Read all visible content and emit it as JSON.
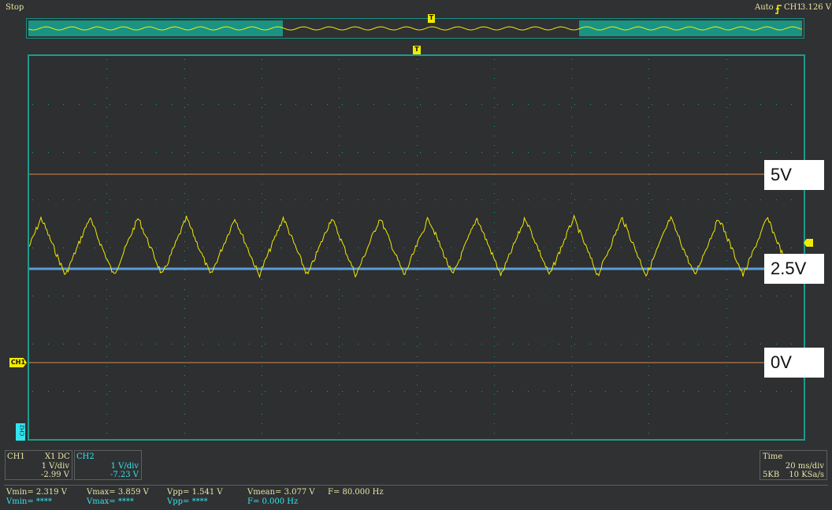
{
  "status": {
    "run_state": "Stop",
    "trigger_mode": "Auto",
    "trigger_channel": "CH1",
    "trigger_level": "3.126 V"
  },
  "markers": {
    "trigger": "T",
    "ch1": "CH1",
    "ch2": "CH2"
  },
  "reference_labels": {
    "top": "5V",
    "middle": "2.5V",
    "bottom": "0V"
  },
  "ch1_panel": {
    "name": "CH1",
    "probe": "X1",
    "coupling": "DC",
    "scale": "1 V/div",
    "offset": "-2.99 V"
  },
  "ch2_panel": {
    "name": "CH2",
    "scale": "1 V/div",
    "offset": "-7.23 V"
  },
  "time_panel": {
    "title": "Time",
    "scale": "20 ms/div",
    "memory": "5KB",
    "sample_rate": "10 KSa/s"
  },
  "measurements": {
    "ch1": {
      "vmin": "Vmin= 2.319 V",
      "vmax": "Vmax= 3.859 V",
      "vpp": "Vpp= 1.541 V",
      "vmean": "Vmean= 3.077 V",
      "freq": "F= 80.000 Hz"
    },
    "ch2": {
      "vmin": "Vmin= ****",
      "vmax": "Vmax= ****",
      "vpp": "Vpp= ****",
      "freq": "F= 0.000 Hz"
    }
  },
  "colors": {
    "ch1": "#f2ea00",
    "ch2": "#35e4ee",
    "grid_frame": "#1b9b8d",
    "ref_5v": "#e0884a",
    "ref_2v5": "#5d9ddc",
    "ref_0v": "#e0884a"
  },
  "waveform": {
    "shape": "triangle",
    "periods_visible": 16,
    "vmin": 2.319,
    "vmax": 3.859
  }
}
